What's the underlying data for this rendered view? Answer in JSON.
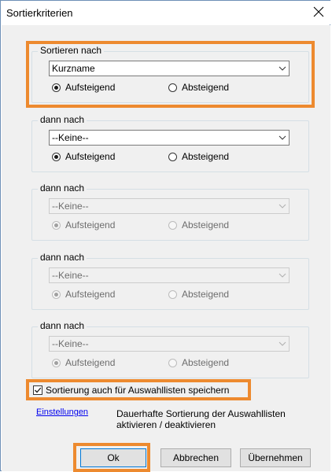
{
  "window": {
    "title": "Sortierkriterien",
    "close_glyph": "✕"
  },
  "groups": [
    {
      "legend": "Sortieren nach",
      "value": "Kurzname",
      "asc_label": "Aufsteigend",
      "desc_label": "Absteigend",
      "asc_checked": true,
      "enabled": true
    },
    {
      "legend": "dann nach",
      "value": "--Keine--",
      "asc_label": "Aufsteigend",
      "desc_label": "Absteigend",
      "asc_checked": true,
      "enabled": true
    },
    {
      "legend": "dann nach",
      "value": "--Keine--",
      "asc_label": "Aufsteigend",
      "desc_label": "Absteigend",
      "asc_checked": true,
      "enabled": false
    },
    {
      "legend": "dann nach",
      "value": "--Keine--",
      "asc_label": "Aufsteigend",
      "desc_label": "Absteigend",
      "asc_checked": true,
      "enabled": false
    },
    {
      "legend": "dann nach",
      "value": "--Keine--",
      "asc_label": "Aufsteigend",
      "desc_label": "Absteigend",
      "asc_checked": true,
      "enabled": false
    }
  ],
  "save_sort": {
    "label": "Sortierung auch für Auswahllisten speichern",
    "checked": true
  },
  "settings": {
    "link_label": "Einstellungen",
    "description_line1": "Dauerhafte Sortierung der Auswahllisten",
    "description_line2": "aktivieren / deaktivieren"
  },
  "buttons": {
    "ok": "Ok",
    "cancel": "Abbrechen",
    "apply": "Übernehmen"
  },
  "colors": {
    "highlight": "#ed8a2f",
    "link": "#0000ee",
    "focus_border": "#0078d7"
  }
}
